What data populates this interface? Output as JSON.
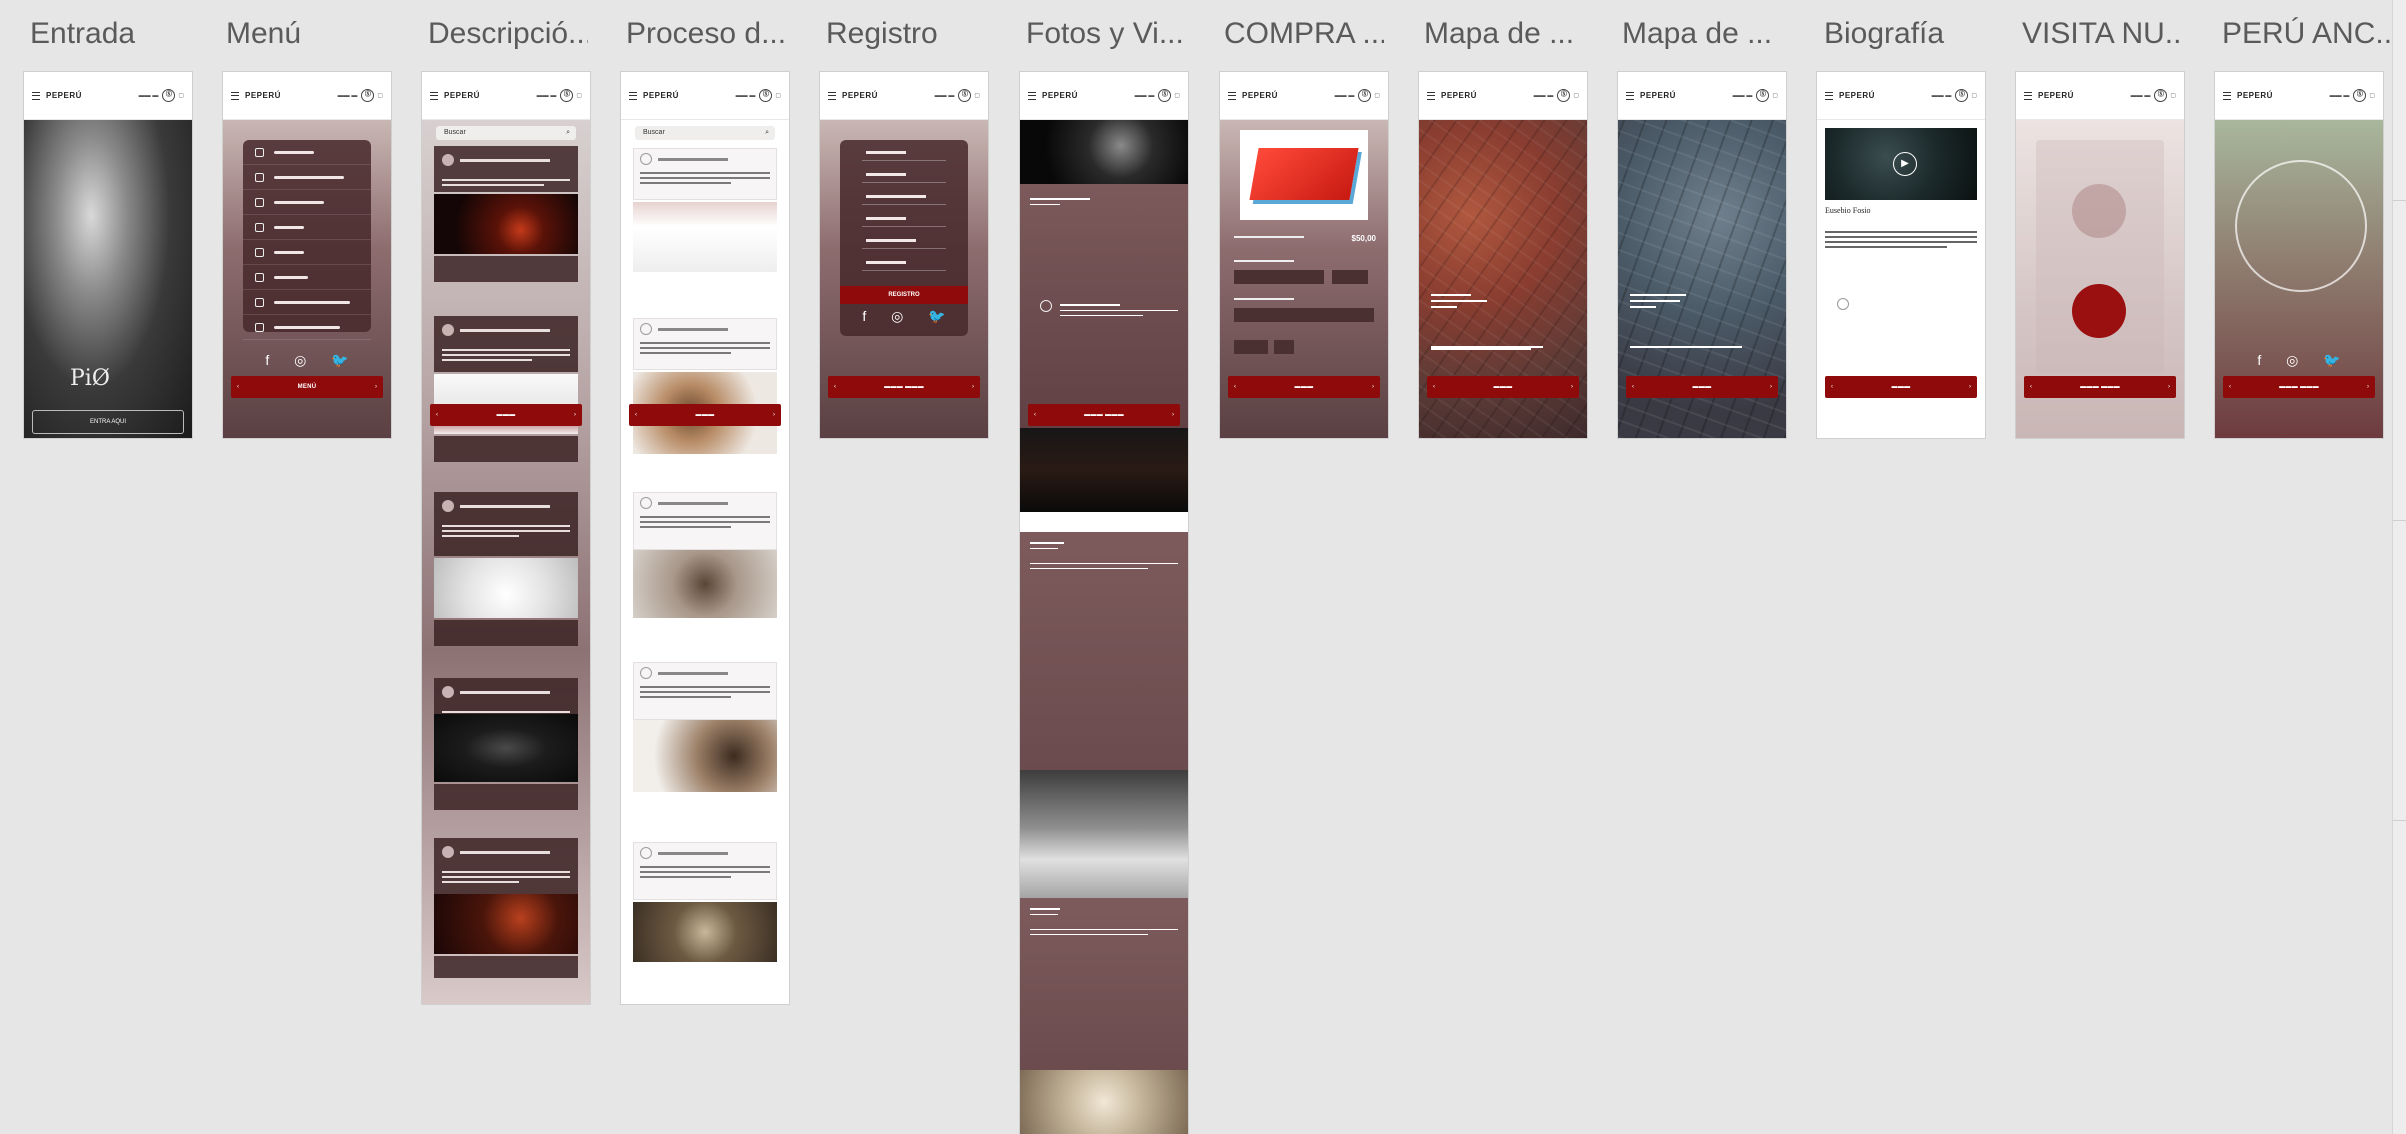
{
  "labels": [
    "Entrada",
    "Menú",
    "Descripció...",
    "Proceso d...",
    "Registro",
    "Fotos y Vi...",
    "COMPRA ...",
    "Mapa de ...",
    "Mapa de ...",
    "Biografía",
    "VISITA NU...",
    "PERÚ ANC..."
  ],
  "header": {
    "brand": "PEPERÚ",
    "mini": "▬▬ ▬",
    "circle": "Ⓢ"
  },
  "entrada": {
    "logo": "PiØ",
    "button": "ENTRA AQUI"
  },
  "menu": {
    "button": "MENÚ"
  },
  "descripcion": {
    "search": "Buscar"
  },
  "proceso": {
    "search": "Buscar"
  },
  "registro": {
    "button": "REGISTRO"
  },
  "compra": {
    "price": "$50,00"
  },
  "biografia": {
    "title": "Eusebio Fosio"
  },
  "social": {
    "facebook": "f",
    "instagram": "◎",
    "twitter": "🐦"
  }
}
